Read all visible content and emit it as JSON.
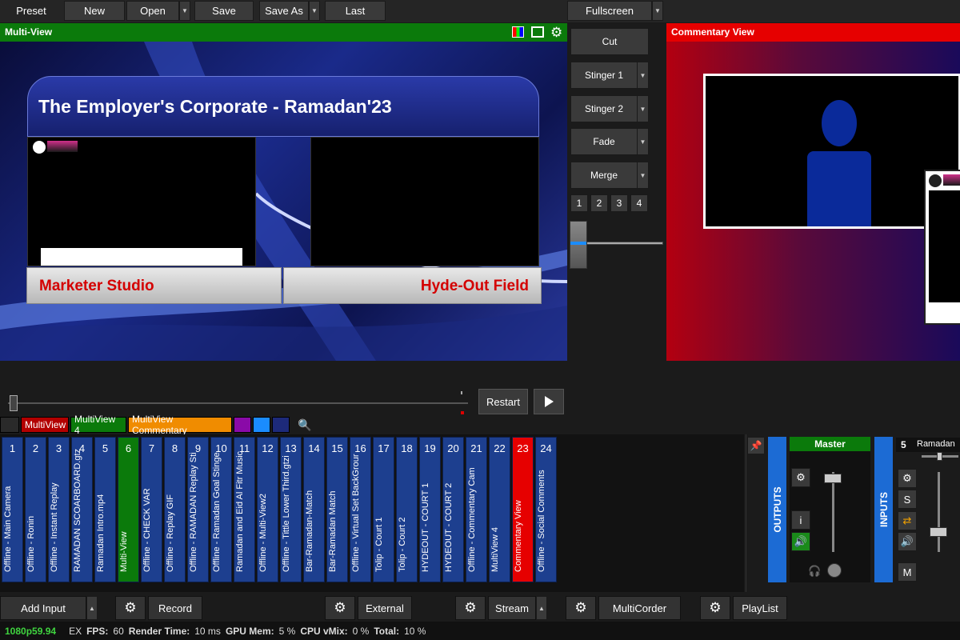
{
  "toolbar": {
    "preset": "Preset",
    "new": "New",
    "open": "Open",
    "save": "Save",
    "save_as": "Save As",
    "last": "Last",
    "fullscreen": "Fullscreen"
  },
  "multiview": {
    "title": "Multi-View",
    "banner": "The Employer's Corporate - Ramadan'23",
    "left_label": "Marketer Studio",
    "right_label": "Hyde-Out Field"
  },
  "commentary": {
    "title": "Commentary View"
  },
  "transitions": {
    "cut": "Cut",
    "stinger1": "Stinger 1",
    "stinger2": "Stinger 2",
    "fade": "Fade",
    "merge": "Merge",
    "numbers": [
      "1",
      "2",
      "3",
      "4"
    ],
    "tbar_position": 0.18
  },
  "scrub": {
    "restart": "Restart",
    "position": 0.0
  },
  "tabs": [
    {
      "label": "MultiView",
      "color": "#b30000"
    },
    {
      "label": "MultiView 4",
      "color": "#0b7a0b"
    },
    {
      "label": "MultiView Commentary",
      "color": "#f08c00"
    },
    {
      "label": "",
      "color": "#8a0aa8"
    },
    {
      "label": "",
      "color": "#1a8cff"
    },
    {
      "label": "",
      "color": "#1d2a7a"
    }
  ],
  "inputs": [
    {
      "num": "1",
      "name": "Offline - Main Camera",
      "state": "normal"
    },
    {
      "num": "2",
      "name": "Offline - Ronin",
      "state": "normal"
    },
    {
      "num": "3",
      "name": "Offline - Instant Replay",
      "state": "normal"
    },
    {
      "num": "4",
      "name": "RAMADAN SCOARBOARD.gtz",
      "state": "normal"
    },
    {
      "num": "5",
      "name": "Ramadan Intro.mp4",
      "state": "normal"
    },
    {
      "num": "6",
      "name": "Multi-View",
      "state": "preview"
    },
    {
      "num": "7",
      "name": "Offline - CHECK VAR",
      "state": "normal"
    },
    {
      "num": "8",
      "name": "Offline - Replay GIF",
      "state": "normal"
    },
    {
      "num": "9",
      "name": "Offline - RAMADAN Replay Sti",
      "state": "normal"
    },
    {
      "num": "10",
      "name": "Offline - Ramadan Goal Stinge",
      "state": "normal"
    },
    {
      "num": "11",
      "name": "Ramadan and Eid Al Fitr Music",
      "state": "normal"
    },
    {
      "num": "12",
      "name": "Offline - Multi-View2",
      "state": "normal"
    },
    {
      "num": "13",
      "name": "Offline - Tittle Lower Third.gtzi",
      "state": "normal"
    },
    {
      "num": "14",
      "name": "Bar-Ramadan-Match",
      "state": "normal"
    },
    {
      "num": "15",
      "name": "Bar-Ramadan Match",
      "state": "normal"
    },
    {
      "num": "16",
      "name": "Offline - Virtual Set BackGrour",
      "state": "normal"
    },
    {
      "num": "17",
      "name": "Tolip - Court 1",
      "state": "normal"
    },
    {
      "num": "18",
      "name": "Tolip - Court 2",
      "state": "normal"
    },
    {
      "num": "19",
      "name": "HYDEOUT - COURT 1",
      "state": "normal"
    },
    {
      "num": "20",
      "name": "HYDEOUT - COURT 2",
      "state": "normal"
    },
    {
      "num": "21",
      "name": "Offline - Commentary Cam",
      "state": "normal"
    },
    {
      "num": "22",
      "name": "MultiView 4",
      "state": "normal"
    },
    {
      "num": "23",
      "name": "Commentary View",
      "state": "program"
    },
    {
      "num": "24",
      "name": "Offline - Social Comments",
      "state": "normal"
    }
  ],
  "audio": {
    "outputs_label": "OUTPUTS",
    "inputs_label": "INPUTS",
    "master_label": "Master",
    "master_level": 0.92,
    "channel_number": "5",
    "channel_name": "Ramadan",
    "channel_level": 0.25,
    "info_label": "i",
    "solo_label": "S",
    "mute_label": "M"
  },
  "bottom": {
    "add_input": "Add Input",
    "record": "Record",
    "external": "External",
    "stream": "Stream",
    "multicorder": "MultiCorder",
    "playlist": "PlayList"
  },
  "status": {
    "format": "1080p59.94",
    "ex": "EX",
    "fps_label": "FPS:",
    "fps_value": "60",
    "render_label": "Render Time:",
    "render_value": "10 ms",
    "gpu_label": "GPU Mem:",
    "gpu_value": "5 %",
    "cpu_label": "CPU vMix:",
    "cpu_value": "0 %",
    "total_label": "Total:",
    "total_value": "10 %"
  }
}
